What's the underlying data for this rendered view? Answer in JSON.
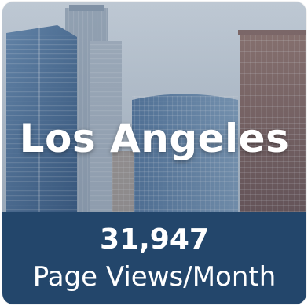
{
  "tile": {
    "city": "Los Angeles",
    "views": "31,947",
    "views_label": "Page Views/Month",
    "image_subject": "downtown-skyline",
    "colors": {
      "stats_bg": "#23466b",
      "text": "#ffffff"
    }
  }
}
